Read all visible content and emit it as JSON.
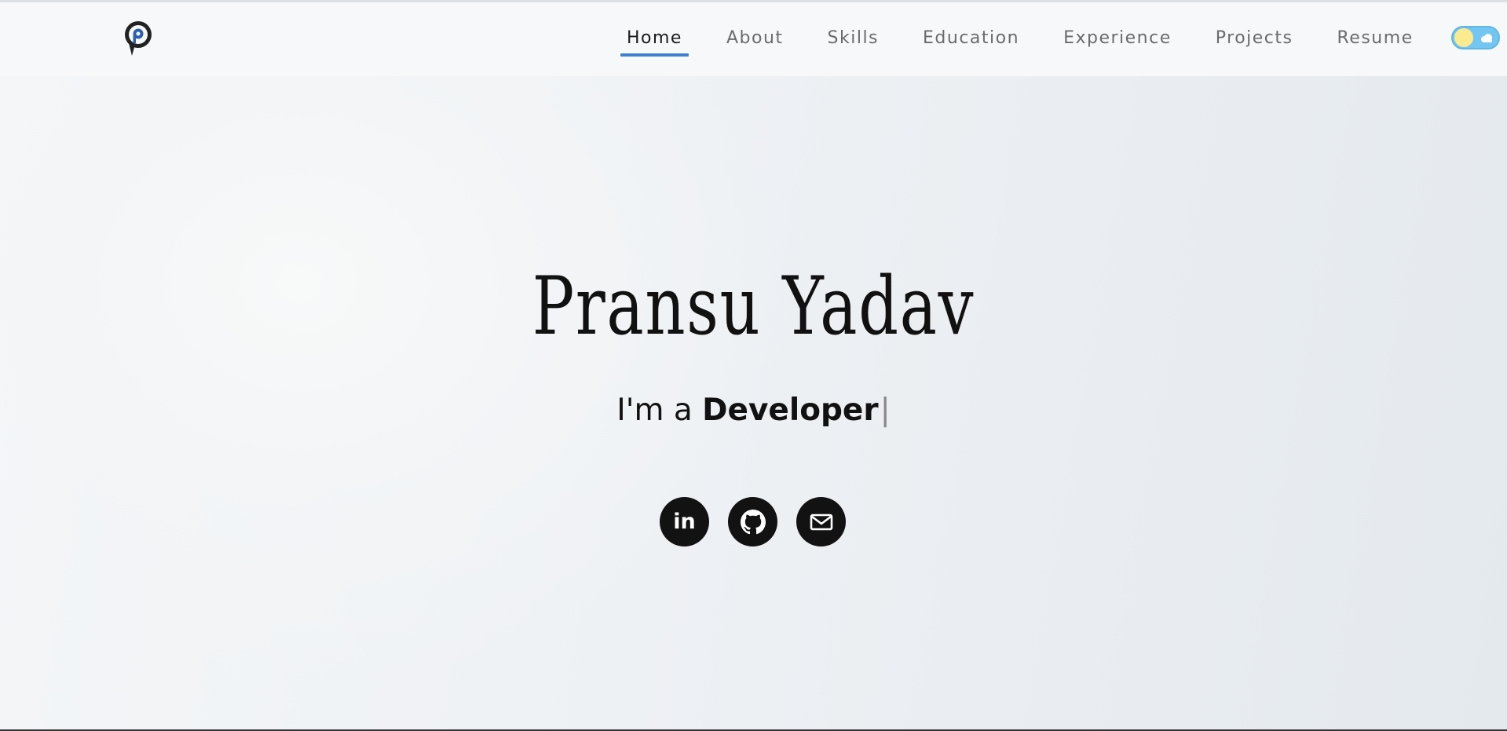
{
  "header": {
    "logo_icon": "logo-p-icon",
    "nav": [
      {
        "label": "Home",
        "active": true
      },
      {
        "label": "About",
        "active": false
      },
      {
        "label": "Skills",
        "active": false
      },
      {
        "label": "Education",
        "active": false
      },
      {
        "label": "Experience",
        "active": false
      },
      {
        "label": "Projects",
        "active": false
      },
      {
        "label": "Resume",
        "active": false
      }
    ],
    "theme_toggle": {
      "state": "light",
      "icon": "sun-cloud-icon"
    }
  },
  "hero": {
    "name": "Pransu Yadav",
    "prefix": "I'm a ",
    "role": "Developer",
    "caret": "|"
  },
  "socials": [
    {
      "name": "linkedin",
      "icon": "linkedin-icon",
      "glyph": "in"
    },
    {
      "name": "github",
      "icon": "github-icon"
    },
    {
      "name": "email",
      "icon": "mail-icon"
    }
  ],
  "colors": {
    "accent": "#3f7fcf",
    "text": "#111111",
    "nav_text": "#6b6b6b",
    "toggle_bg": "#74c6f2",
    "sun": "#fbeb8e"
  }
}
